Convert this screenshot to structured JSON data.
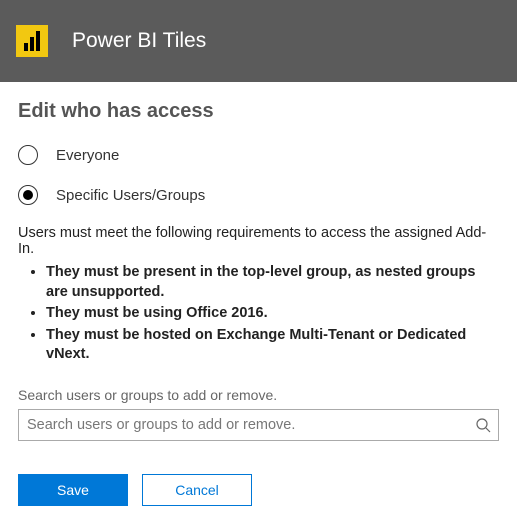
{
  "header": {
    "title": "Power BI Tiles",
    "logo_name": "power-bi-logo"
  },
  "section": {
    "heading": "Edit who has access"
  },
  "options": {
    "everyone": {
      "label": "Everyone",
      "selected": false
    },
    "specific": {
      "label": "Specific Users/Groups",
      "selected": true
    }
  },
  "requirements": {
    "intro": "Users must meet the following requirements to access the assigned Add-In.",
    "items": [
      "They must be present in the top-level group, as nested groups are unsupported.",
      "They must be using Office 2016.",
      "They must be hosted on Exchange Multi-Tenant or Dedicated vNext."
    ]
  },
  "search": {
    "label": "Search users or groups to add or remove.",
    "placeholder": "Search users or groups to add or remove.",
    "value": ""
  },
  "buttons": {
    "save": "Save",
    "cancel": "Cancel"
  },
  "colors": {
    "header_bg": "#5b5b5b",
    "accent": "#0078d7",
    "logo_bg": "#f2c811"
  }
}
